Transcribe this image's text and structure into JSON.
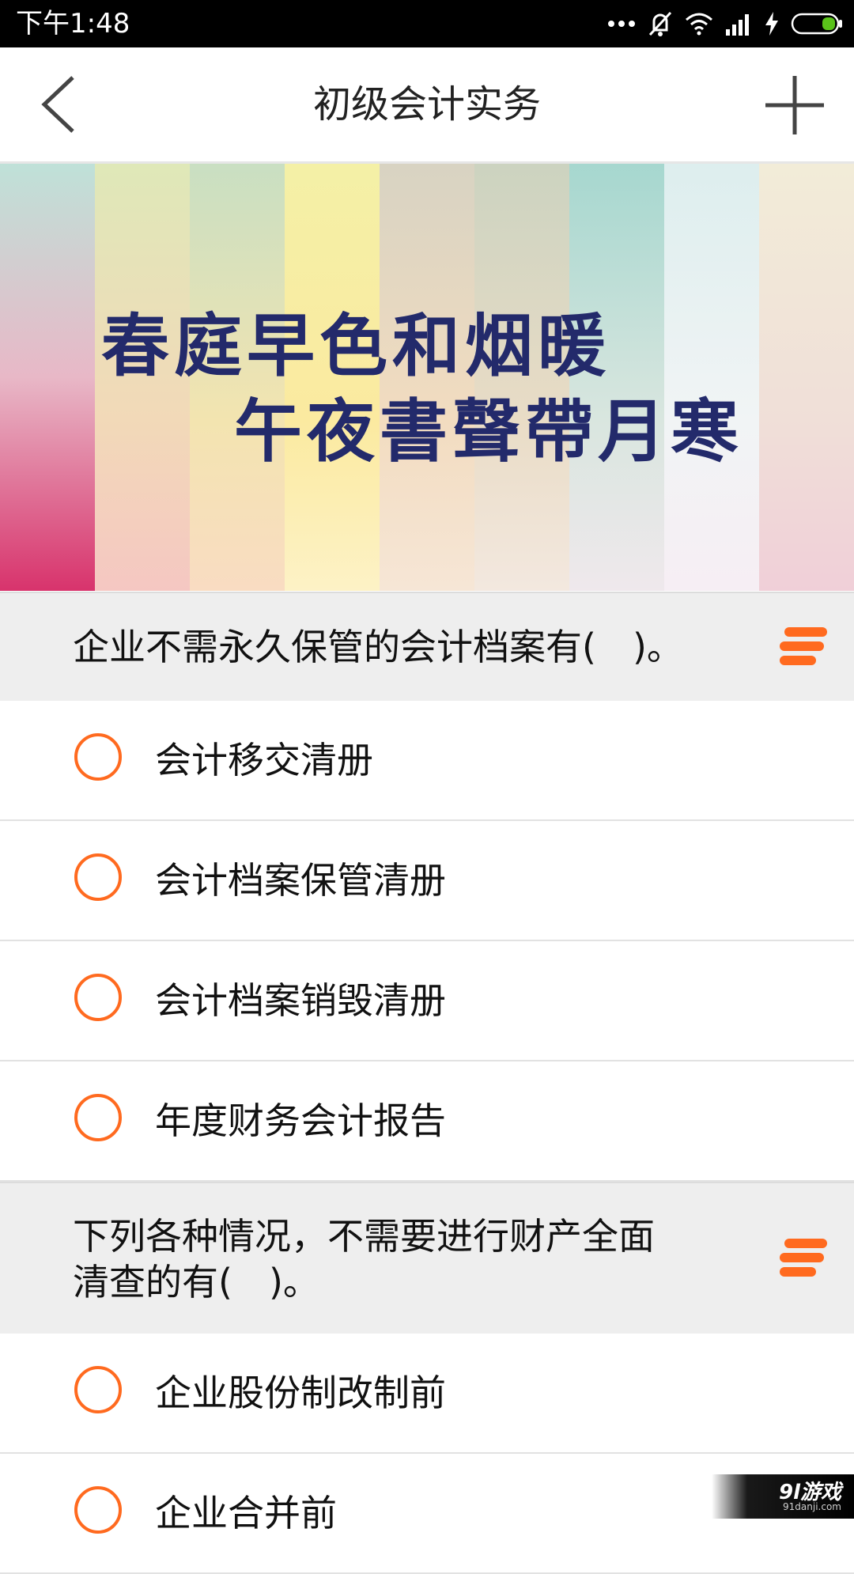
{
  "status_bar": {
    "time": "下午1:48",
    "icons": [
      "more-dots-icon",
      "mute-bell-icon",
      "wifi-icon",
      "signal-icon",
      "charging-bolt-icon",
      "battery-icon"
    ]
  },
  "toolbar": {
    "title": "初级会计实务",
    "back_icon": "chevron-left-icon",
    "add_icon": "plus-icon"
  },
  "banner": {
    "line1": "春庭早色和烟暖",
    "line2": "午夜書聲帶月寒"
  },
  "questions": [
    {
      "text": "企业不需永久保管的会计档案有(　)。",
      "options": [
        "会计移交清册",
        "会计档案保管清册",
        "会计档案销毁清册",
        "年度财务会计报告"
      ]
    },
    {
      "text_line1": "下列各种情况，不需要进行财产全面",
      "text_line2": "清查的有(　)。",
      "options": [
        "企业股份制改制前",
        "企业合并前"
      ]
    }
  ],
  "colors": {
    "accent": "#ff6a1f",
    "question_bg": "#eeeeee",
    "banner_text": "#232a6b"
  },
  "watermark": {
    "brand": "9l游戏",
    "site": "91danji.com"
  }
}
